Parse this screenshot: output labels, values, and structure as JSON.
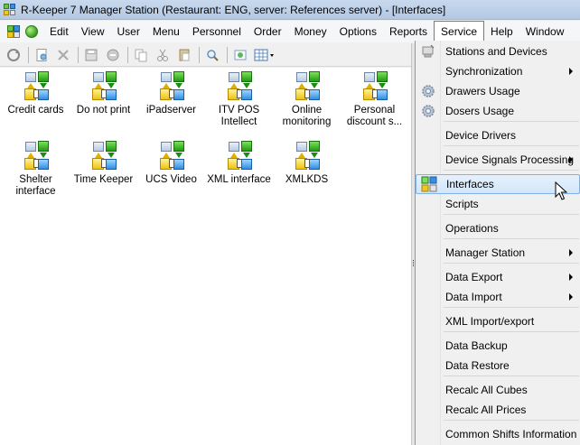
{
  "window": {
    "title": "R-Keeper 7 Manager Station (Restaurant: ENG, server: References server) - [Interfaces]"
  },
  "menubar": {
    "items": [
      "Edit",
      "View",
      "User",
      "Menu",
      "Personnel",
      "Order",
      "Money",
      "Options",
      "Reports",
      "Service",
      "Help",
      "Window"
    ],
    "active": "Service"
  },
  "toolbar": {
    "icons": [
      "refresh-icon",
      "new-icon",
      "delete-icon",
      "save-icon",
      "cancel-icon",
      "copy-icon",
      "cut-icon",
      "paste-icon",
      "find-icon",
      "properties-icon",
      "view-mode-icon"
    ]
  },
  "interfaces": {
    "items": [
      {
        "label": "Credit cards"
      },
      {
        "label": "Do not print"
      },
      {
        "label": "iPadserver"
      },
      {
        "label": "ITV POS Intellect"
      },
      {
        "label": "Online monitoring"
      },
      {
        "label": "Personal discount s..."
      },
      {
        "label": "Shelter interface"
      },
      {
        "label": "Time Keeper"
      },
      {
        "label": "UCS Video"
      },
      {
        "label": "XML interface"
      },
      {
        "label": "XMLKDS"
      }
    ]
  },
  "service_menu": {
    "items": [
      {
        "label": "Stations and Devices",
        "icon": "stations-icon",
        "submenu": false
      },
      {
        "label": "Synchronization",
        "submenu": true
      },
      {
        "label": "Drawers Usage",
        "icon": "gear-icon",
        "submenu": false
      },
      {
        "label": "Dosers Usage",
        "icon": "gear-icon",
        "submenu": false
      },
      {
        "label": "Device Drivers",
        "submenu": false
      },
      {
        "label": "Device Signals Processing",
        "submenu": true
      },
      {
        "label": "Interfaces",
        "icon": "interfaces-icon",
        "submenu": false,
        "highlighted": true
      },
      {
        "label": "Scripts",
        "submenu": false
      },
      {
        "label": "Operations",
        "submenu": false
      },
      {
        "label": "Manager Station",
        "submenu": true
      },
      {
        "label": "Data Export",
        "submenu": true
      },
      {
        "label": "Data Import",
        "submenu": true
      },
      {
        "label": "XML Import/export",
        "submenu": false
      },
      {
        "label": "Data Backup",
        "submenu": false
      },
      {
        "label": "Data Restore",
        "submenu": false
      },
      {
        "label": "Recalc All Cubes",
        "submenu": false
      },
      {
        "label": "Recalc All Prices",
        "submenu": false
      },
      {
        "label": "Common Shifts Information",
        "submenu": false
      }
    ]
  },
  "colors": {
    "titlebar": "#c4d5ec",
    "highlight": "#d3e6fa",
    "highlight_border": "#7fb2e8"
  }
}
